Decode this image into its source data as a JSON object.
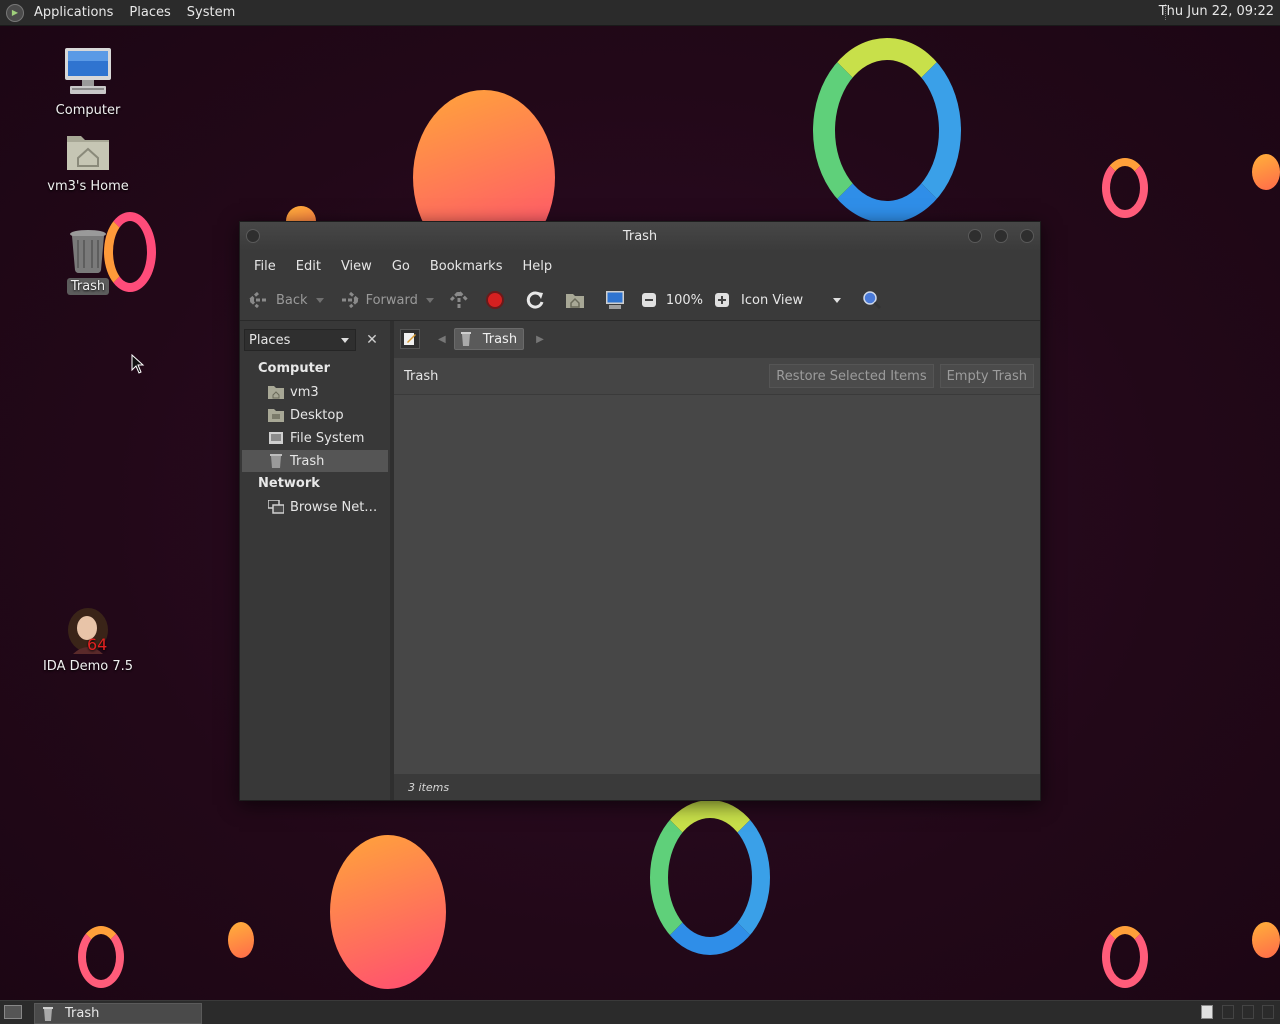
{
  "top_panel": {
    "menus": [
      "Applications",
      "Places",
      "System"
    ],
    "clock": "Thu Jun 22, 09:22"
  },
  "desktop_icons": {
    "computer": "Computer",
    "home": "vm3's Home",
    "trash": "Trash",
    "ida": "IDA Demo 7.5"
  },
  "window": {
    "title": "Trash",
    "menus": [
      "File",
      "Edit",
      "View",
      "Go",
      "Bookmarks",
      "Help"
    ],
    "toolbar": {
      "back": "Back",
      "forward": "Forward",
      "zoom": "100%",
      "view_mode": "Icon View"
    },
    "sidebar": {
      "combo": "Places",
      "sections": [
        {
          "heading": "Computer",
          "items": [
            "vm3",
            "Desktop",
            "File System",
            "Trash"
          ]
        },
        {
          "heading": "Network",
          "items": [
            "Browse Net…"
          ]
        }
      ]
    },
    "pathbar": {
      "crumb": "Trash"
    },
    "infobar": {
      "title": "Trash",
      "restore": "Restore Selected Items",
      "empty": "Empty Trash"
    },
    "status": "3 items"
  },
  "taskbar": {
    "task": "Trash"
  },
  "colors": {
    "desktop_bg": "#220818",
    "accent_orange": "#ff8a3d",
    "accent_pink": "#ff3c78"
  }
}
